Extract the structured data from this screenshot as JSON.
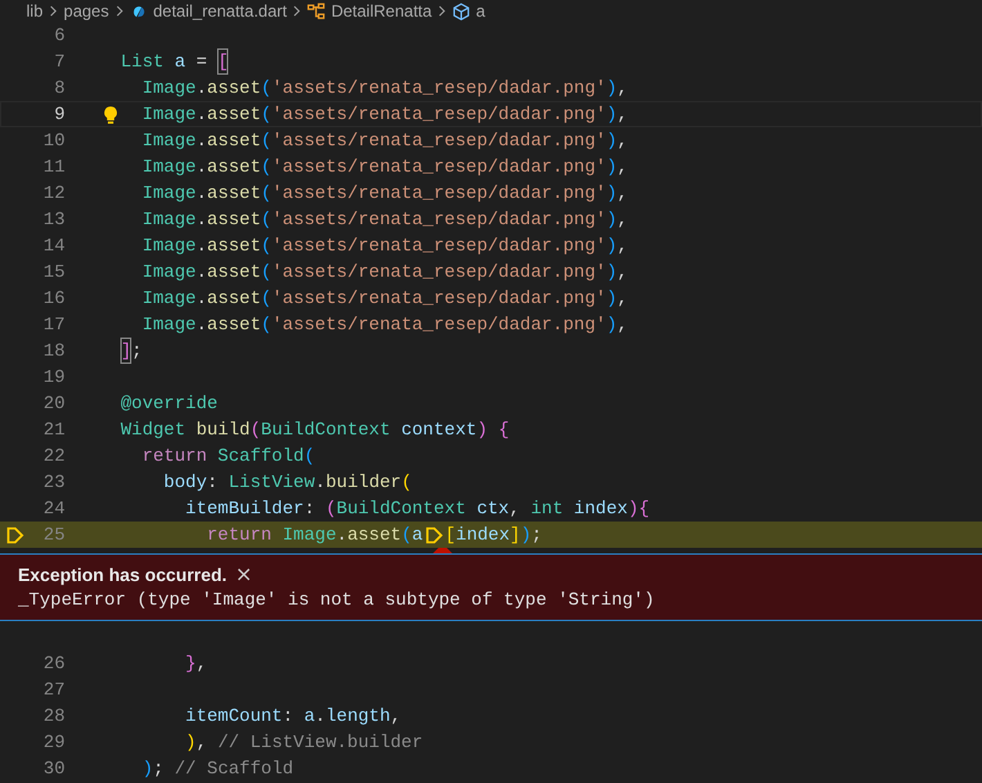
{
  "breadcrumbs": [
    {
      "kind": "folder",
      "label": "lib"
    },
    {
      "kind": "folder",
      "label": "pages"
    },
    {
      "kind": "file",
      "label": "detail_renatta.dart"
    },
    {
      "kind": "class",
      "label": "DetailRenatta"
    },
    {
      "kind": "variable",
      "label": "a"
    }
  ],
  "lines_before": [
    {
      "number": "6",
      "kind": "plain"
    },
    {
      "number": "7",
      "kind": "plain",
      "tokens": [
        {
          "kind": "type",
          "text": "    List"
        },
        {
          "kind": "var",
          "text": " a"
        },
        {
          "kind": "plain",
          "text": " = "
        },
        {
          "kind": "bracket-match",
          "text": "["
        }
      ]
    },
    {
      "number": "8",
      "kind": "plain",
      "tokens": [
        {
          "kind": "type",
          "text": "      Image"
        },
        {
          "kind": "plain",
          "text": "."
        },
        {
          "kind": "func",
          "text": "asset"
        },
        {
          "kind": "bracket3",
          "text": "("
        },
        {
          "kind": "string",
          "text": "'assets/renata_resep/dadar.png'"
        },
        {
          "kind": "bracket3",
          "text": ")"
        },
        {
          "kind": "plain",
          "text": ","
        }
      ]
    },
    {
      "number": "9",
      "kind": "cursor",
      "tokens": [
        {
          "kind": "type",
          "text": "      Image"
        },
        {
          "kind": "plain",
          "text": "."
        },
        {
          "kind": "func",
          "text": "asset"
        },
        {
          "kind": "bracket3",
          "text": "("
        },
        {
          "kind": "string",
          "text": "'assets/renata_resep/dadar.png'"
        },
        {
          "kind": "bracket3",
          "text": ")"
        },
        {
          "kind": "plain",
          "text": ","
        }
      ]
    },
    {
      "number": "10",
      "kind": "plain",
      "tokens": [
        {
          "kind": "type",
          "text": "      Image"
        },
        {
          "kind": "plain",
          "text": "."
        },
        {
          "kind": "func",
          "text": "asset"
        },
        {
          "kind": "bracket3",
          "text": "("
        },
        {
          "kind": "string",
          "text": "'assets/renata_resep/dadar.png'"
        },
        {
          "kind": "bracket3",
          "text": ")"
        },
        {
          "kind": "plain",
          "text": ","
        }
      ]
    },
    {
      "number": "11",
      "kind": "plain",
      "tokens": [
        {
          "kind": "type",
          "text": "      Image"
        },
        {
          "kind": "plain",
          "text": "."
        },
        {
          "kind": "func",
          "text": "asset"
        },
        {
          "kind": "bracket3",
          "text": "("
        },
        {
          "kind": "string",
          "text": "'assets/renata_resep/dadar.png'"
        },
        {
          "kind": "bracket3",
          "text": ")"
        },
        {
          "kind": "plain",
          "text": ","
        }
      ]
    },
    {
      "number": "12",
      "kind": "plain",
      "tokens": [
        {
          "kind": "type",
          "text": "      Image"
        },
        {
          "kind": "plain",
          "text": "."
        },
        {
          "kind": "func",
          "text": "asset"
        },
        {
          "kind": "bracket3",
          "text": "("
        },
        {
          "kind": "string",
          "text": "'assets/renata_resep/dadar.png'"
        },
        {
          "kind": "bracket3",
          "text": ")"
        },
        {
          "kind": "plain",
          "text": ","
        }
      ]
    },
    {
      "number": "13",
      "kind": "plain",
      "tokens": [
        {
          "kind": "type",
          "text": "      Image"
        },
        {
          "kind": "plain",
          "text": "."
        },
        {
          "kind": "func",
          "text": "asset"
        },
        {
          "kind": "bracket3",
          "text": "("
        },
        {
          "kind": "string",
          "text": "'assets/renata_resep/dadar.png'"
        },
        {
          "kind": "bracket3",
          "text": ")"
        },
        {
          "kind": "plain",
          "text": ","
        }
      ]
    },
    {
      "number": "14",
      "kind": "plain",
      "tokens": [
        {
          "kind": "type",
          "text": "      Image"
        },
        {
          "kind": "plain",
          "text": "."
        },
        {
          "kind": "func",
          "text": "asset"
        },
        {
          "kind": "bracket3",
          "text": "("
        },
        {
          "kind": "string",
          "text": "'assets/renata_resep/dadar.png'"
        },
        {
          "kind": "bracket3",
          "text": ")"
        },
        {
          "kind": "plain",
          "text": ","
        }
      ]
    },
    {
      "number": "15",
      "kind": "plain",
      "tokens": [
        {
          "kind": "type",
          "text": "      Image"
        },
        {
          "kind": "plain",
          "text": "."
        },
        {
          "kind": "func",
          "text": "asset"
        },
        {
          "kind": "bracket3",
          "text": "("
        },
        {
          "kind": "string",
          "text": "'assets/renata_resep/dadar.png'"
        },
        {
          "kind": "bracket3",
          "text": ")"
        },
        {
          "kind": "plain",
          "text": ","
        }
      ]
    },
    {
      "number": "16",
      "kind": "plain",
      "tokens": [
        {
          "kind": "type",
          "text": "      Image"
        },
        {
          "kind": "plain",
          "text": "."
        },
        {
          "kind": "func",
          "text": "asset"
        },
        {
          "kind": "bracket3",
          "text": "("
        },
        {
          "kind": "string",
          "text": "'assets/renata_resep/dadar.png'"
        },
        {
          "kind": "bracket3",
          "text": ")"
        },
        {
          "kind": "plain",
          "text": ","
        }
      ]
    },
    {
      "number": "17",
      "kind": "plain",
      "tokens": [
        {
          "kind": "type",
          "text": "      Image"
        },
        {
          "kind": "plain",
          "text": "."
        },
        {
          "kind": "func",
          "text": "asset"
        },
        {
          "kind": "bracket3",
          "text": "("
        },
        {
          "kind": "string",
          "text": "'assets/renata_resep/dadar.png'"
        },
        {
          "kind": "bracket3",
          "text": ")"
        },
        {
          "kind": "plain",
          "text": ","
        }
      ]
    },
    {
      "number": "18",
      "kind": "plain",
      "tokens": [
        {
          "kind": "bracket-match",
          "text": "    ]"
        },
        {
          "kind": "plain",
          "text": ";"
        }
      ]
    },
    {
      "number": "19",
      "kind": "plain"
    },
    {
      "number": "20",
      "kind": "plain",
      "tokens": [
        {
          "kind": "type",
          "text": "    @override"
        }
      ]
    },
    {
      "number": "21",
      "kind": "plain",
      "tokens": [
        {
          "kind": "type",
          "text": "    Widget"
        },
        {
          "kind": "func",
          "text": " build"
        },
        {
          "kind": "bracket2",
          "text": "("
        },
        {
          "kind": "type",
          "text": "BuildContext"
        },
        {
          "kind": "var",
          "text": " context"
        },
        {
          "kind": "bracket2",
          "text": ")"
        },
        {
          "kind": "bracket2",
          "text": " {"
        }
      ]
    },
    {
      "number": "22",
      "kind": "plain",
      "tokens": [
        {
          "kind": "keyword",
          "text": "      return"
        },
        {
          "kind": "type",
          "text": " Scaffold"
        },
        {
          "kind": "bracket3",
          "text": "("
        }
      ]
    },
    {
      "number": "23",
      "kind": "plain",
      "tokens": [
        {
          "kind": "var",
          "text": "        body"
        },
        {
          "kind": "plain",
          "text": ": "
        },
        {
          "kind": "type",
          "text": "ListView"
        },
        {
          "kind": "plain",
          "text": "."
        },
        {
          "kind": "func",
          "text": "builder"
        },
        {
          "kind": "bracket1",
          "text": "("
        }
      ]
    },
    {
      "number": "24",
      "kind": "plain",
      "tokens": [
        {
          "kind": "var",
          "text": "          itemBuilder"
        },
        {
          "kind": "plain",
          "text": ": "
        },
        {
          "kind": "bracket2",
          "text": "("
        },
        {
          "kind": "type",
          "text": "BuildContext"
        },
        {
          "kind": "var",
          "text": " ctx"
        },
        {
          "kind": "plain",
          "text": ", "
        },
        {
          "kind": "type",
          "text": "int"
        },
        {
          "kind": "var",
          "text": " index"
        },
        {
          "kind": "bracket2",
          "text": ")"
        },
        {
          "kind": "bracket2",
          "text": "{"
        }
      ]
    },
    {
      "number": "25",
      "kind": "exception",
      "tokens": [
        {
          "kind": "keyword",
          "text": "            return"
        },
        {
          "kind": "type",
          "text": " Image"
        },
        {
          "kind": "plain",
          "text": "."
        },
        {
          "kind": "func",
          "text": "asset"
        },
        {
          "kind": "bracket3",
          "text": "("
        },
        {
          "kind": "var",
          "text": "a"
        },
        {
          "kind": "stop"
        },
        {
          "kind": "bracket1",
          "text": "["
        },
        {
          "kind": "var",
          "text": "index"
        },
        {
          "kind": "bracket1",
          "text": "]"
        },
        {
          "kind": "bracket3",
          "text": ")"
        },
        {
          "kind": "plain",
          "text": ";"
        }
      ]
    }
  ],
  "exception": {
    "title": "Exception has occurred.",
    "close": "×",
    "message": "_TypeError (type 'Image' is not a subtype of type 'String')"
  },
  "lines_after": [
    {
      "number": "26",
      "tokens": [
        {
          "kind": "bracket2",
          "text": "          }"
        },
        {
          "kind": "plain",
          "text": ","
        }
      ]
    },
    {
      "number": "27"
    },
    {
      "number": "28",
      "tokens": [
        {
          "kind": "var",
          "text": "          itemCount"
        },
        {
          "kind": "plain",
          "text": ": "
        },
        {
          "kind": "var",
          "text": "a"
        },
        {
          "kind": "plain",
          "text": "."
        },
        {
          "kind": "var",
          "text": "length"
        },
        {
          "kind": "plain",
          "text": ","
        }
      ]
    },
    {
      "number": "29",
      "tokens": [
        {
          "kind": "bracket1",
          "text": "          )"
        },
        {
          "kind": "plain",
          "text": ", "
        },
        {
          "kind": "comment",
          "text": "// ListView.builder"
        }
      ]
    },
    {
      "number": "30",
      "tokens": [
        {
          "kind": "bracket3",
          "text": "      )"
        },
        {
          "kind": "plain",
          "text": "; "
        },
        {
          "kind": "comment",
          "text": "// Scaffold"
        }
      ]
    }
  ]
}
